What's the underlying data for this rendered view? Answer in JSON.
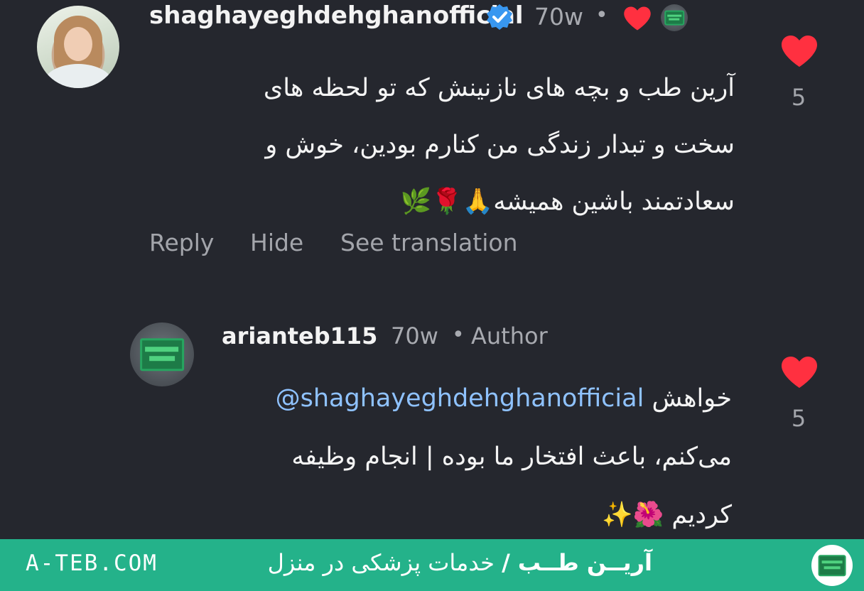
{
  "comments": [
    {
      "username": "shaghayeghdehghanofficial",
      "time": "70w",
      "text_lines": [
        "آرین طب و بچه های نازنینش که تو لحظه های",
        "سخت و تبدار زندگی من کنارم بودین، خوش و",
        "سعادتمند باشین همیشه🙏🌹🌿"
      ],
      "like_count": "5",
      "actions": {
        "reply": "Reply",
        "hide": "Hide",
        "translate": "See translation"
      }
    },
    {
      "username": "arianteb115",
      "time": "70w",
      "role": "Author",
      "mention": "@shaghayeghdehghanofficial",
      "line1_suffix": "خواهش",
      "text_lines": [
        "می‌کنم، باعث افتخار ما بوده | انجام وظیفه",
        "کردیم 🌺✨"
      ],
      "like_count": "5"
    }
  ],
  "footer": {
    "site": "A-TEB.COM",
    "brand": "آریــن طــب /",
    "tagline": "خدمات پزشکی در منزل"
  },
  "colors": {
    "background": "#25272e",
    "heart": "#ff3040",
    "verified": "#3897f0",
    "mention": "#8fc2ff",
    "footer": "#24b28a"
  },
  "icons": [
    "verified-badge-icon",
    "heart-icon",
    "creator-avatar-icon",
    "logo-icon"
  ]
}
